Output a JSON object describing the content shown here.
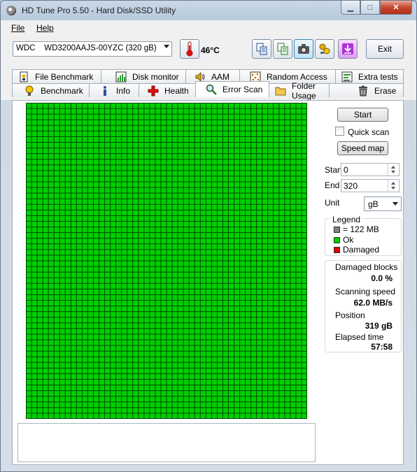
{
  "window": {
    "title": "HD Tune Pro 5.50 - Hard Disk/SSD Utility",
    "minimize": "▁",
    "maximize": "□",
    "close": "✕"
  },
  "menu": {
    "file": "File",
    "help": "Help"
  },
  "toolbar": {
    "drive": "WDC    WD3200AAJS-00YZC (320 gB)",
    "temperature": "46",
    "temperature_unit": "°C",
    "exit_label": "Exit"
  },
  "tabs": {
    "top_row": [
      {
        "label": "File Benchmark",
        "icon": "file-benchmark-icon"
      },
      {
        "label": "Disk monitor",
        "icon": "disk-monitor-icon"
      },
      {
        "label": "AAM",
        "icon": "speaker-icon"
      },
      {
        "label": "Random Access",
        "icon": "random-access-icon"
      },
      {
        "label": "Extra tests",
        "icon": "extra-tests-icon"
      }
    ],
    "bottom_row": [
      {
        "label": "Benchmark",
        "icon": "benchmark-icon"
      },
      {
        "label": "Info",
        "icon": "info-icon"
      },
      {
        "label": "Health",
        "icon": "health-icon"
      },
      {
        "label": "Error Scan",
        "icon": "magnifier-icon",
        "active": true
      },
      {
        "label": "Folder Usage",
        "icon": "folder-icon"
      },
      {
        "label": "Erase",
        "icon": "trash-icon"
      }
    ]
  },
  "scan_panel": {
    "start_button": "Start",
    "quick_scan_label": "Quick scan",
    "quick_scan_checked": false,
    "speed_map_button": "Speed map",
    "start_label": "Start",
    "start_value": "0",
    "end_label": "End",
    "end_value": "320",
    "unit_label": "Unit",
    "unit_value": "gB"
  },
  "legend": {
    "title": "Legend",
    "items": [
      {
        "label": "= 122 MB",
        "color": "#808080"
      },
      {
        "label": "Ok",
        "color": "#00d000"
      },
      {
        "label": "Damaged",
        "color": "#e00000"
      }
    ]
  },
  "stats": {
    "damaged_blocks_label": "Damaged blocks",
    "damaged_blocks_value": "0.0 %",
    "scanning_speed_label": "Scanning speed",
    "scanning_speed_value": "62.0 MB/s",
    "position_label": "Position",
    "position_value": "319 gB",
    "elapsed_label": "Elapsed time",
    "elapsed_value": "57:58"
  },
  "scan_grid": {
    "columns": 50,
    "rows": 56,
    "status": "ok",
    "ok_color": "#00d000",
    "line_color": "#004800"
  },
  "colors": {
    "accent": "#3b6fb6",
    "close_button": "#c7462f",
    "tab_border": "#a3adb8"
  }
}
